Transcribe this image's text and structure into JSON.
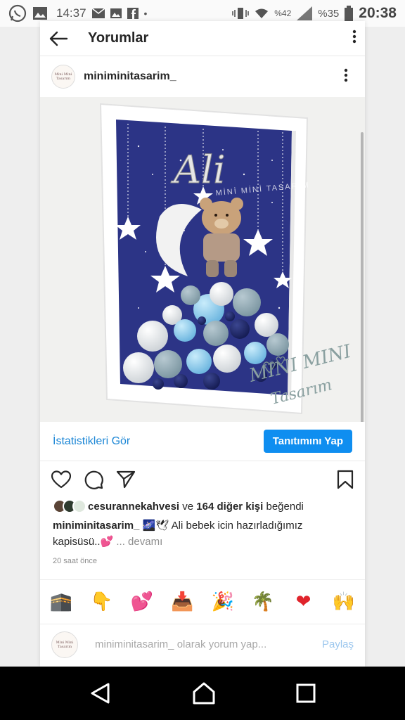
{
  "status_bar": {
    "time_left": "14:37",
    "signal_text": "%42",
    "battery_text": "%35",
    "clock": "20:38"
  },
  "header": {
    "title": "Yorumlar"
  },
  "post": {
    "username": "miniminitasarim_",
    "avatar_text": "Mini Mini Tasarım",
    "image": {
      "name_text": "Ali",
      "watermark_top": "MİNİ MİNİ TASARIM",
      "watermark_bottom_1": "MINI MINI",
      "watermark_bottom_2": "Tasarım"
    },
    "stats_label": "İstatistikleri Gör",
    "promote_label": "Tanıtımını Yap",
    "likes": {
      "first_user": "cesurannekahvesi",
      "connector": " ve ",
      "others": "164 diğer kişi",
      "suffix": " beğendi"
    },
    "caption": {
      "username": "miniminitasarim_",
      "emojis_inline": "🌌🕊",
      "text": " Ali bebek icin hazırladığımız kapisüsü..💕",
      "more": "... devamı"
    },
    "timestamp": "20 saat önce"
  },
  "emoji_bar": [
    "🕋",
    "👇",
    "💕",
    "📥",
    "🎉",
    "🌴",
    "❤",
    "🙌"
  ],
  "comment": {
    "placeholder": "miniminitasarim_ olarak yorum yap...",
    "share_label": "Paylaş"
  },
  "icons": {
    "heart": "heart-icon",
    "comment": "comment-icon",
    "send": "send-icon",
    "bookmark": "bookmark-icon"
  },
  "colors": {
    "link_blue": "#1d87d6",
    "button_blue": "#0f8ef0",
    "frame_navy": "#2c3486"
  }
}
